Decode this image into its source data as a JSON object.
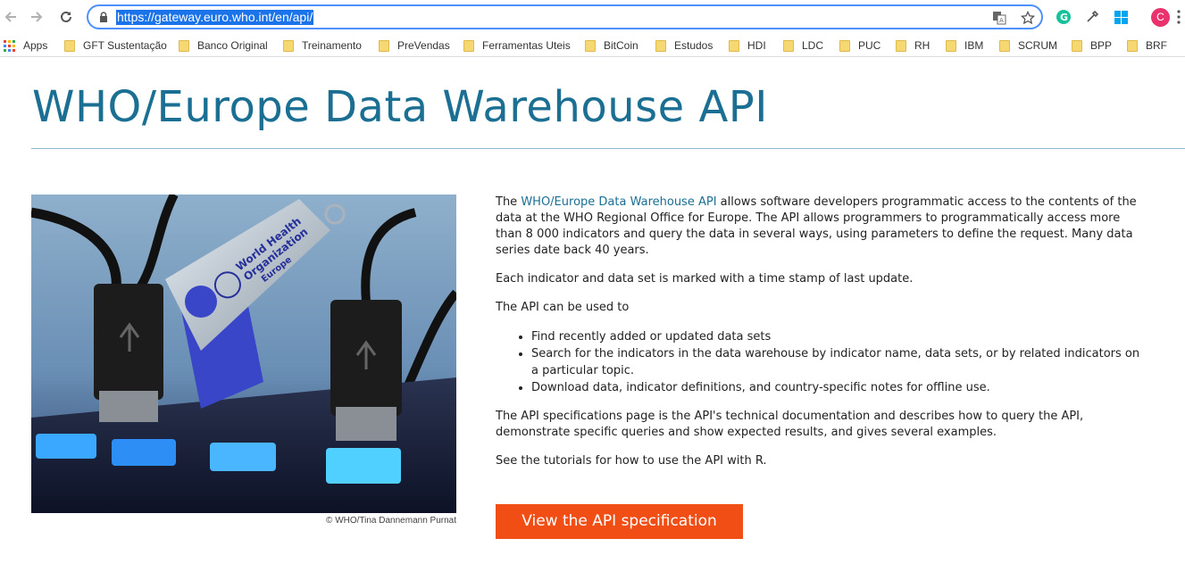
{
  "browser": {
    "url": "https://gateway.euro.who.int/en/api/",
    "avatar_letter": "C",
    "icons": {
      "back": "arrow-left-icon",
      "forward": "arrow-right-icon",
      "reload": "reload-icon",
      "lock": "lock-icon",
      "translate": "translate-icon",
      "bookmark": "star-icon",
      "grammarly": "grammarly-icon",
      "eyedropper": "eyedropper-icon",
      "windows": "windows-icon",
      "menu": "kebab-menu-icon"
    }
  },
  "bookmarks": [
    {
      "label": "Apps",
      "icon": "apps-grid-icon"
    },
    {
      "label": "GFT Sustentação",
      "icon": "folder-icon"
    },
    {
      "label": "Banco Original",
      "icon": "folder-icon"
    },
    {
      "label": "Treinamento",
      "icon": "folder-icon"
    },
    {
      "label": "PreVendas",
      "icon": "folder-icon"
    },
    {
      "label": "Ferramentas Uteis",
      "icon": "folder-icon"
    },
    {
      "label": "BitCoin",
      "icon": "folder-icon"
    },
    {
      "label": "Estudos",
      "icon": "folder-icon"
    },
    {
      "label": "HDI",
      "icon": "folder-icon"
    },
    {
      "label": "LDC",
      "icon": "folder-icon"
    },
    {
      "label": "PUC",
      "icon": "folder-icon"
    },
    {
      "label": "RH",
      "icon": "folder-icon"
    },
    {
      "label": "IBM",
      "icon": "folder-icon"
    },
    {
      "label": "SCRUM",
      "icon": "folder-icon"
    },
    {
      "label": "BPP",
      "icon": "folder-icon"
    },
    {
      "label": "BRF",
      "icon": "folder-icon"
    }
  ],
  "page": {
    "title": "WHO/Europe Data Warehouse API",
    "image_credit": "© WHO/Tina Dannemann Purnat",
    "usb_text_1": "World Health",
    "usb_text_2": "Organization",
    "usb_text_3": "Europe",
    "intro_prefix": "The ",
    "intro_link": "WHO/Europe Data Warehouse API",
    "intro_rest": " allows software developers programmatic access to the contents of the data at the WHO Regional Office for Europe. The API allows programmers to programmatically access more than 8 000 indicators and query the data in several ways, using parameters to define the request. Many data series date back 40 years.",
    "timestamp_note": "Each indicator and data set is marked with a time stamp of last update.",
    "uses_intro": "The API can be used to",
    "uses": [
      "Find recently added or updated data sets",
      "Search for the indicators in the data warehouse by indicator name, data sets, or by related indicators on a particular topic.",
      "Download data, indicator definitions, and country-specific notes for offline use."
    ],
    "spec_note": "The API specifications page is the API's technical documentation and describes how to query the API, demonstrate specific queries and show expected results, and gives several examples.",
    "tutorial_note": "See the tutorials for how to use the API with R.",
    "button_label": "View the API specification",
    "colors": {
      "title": "#1b6f92",
      "link": "#1b6f92",
      "button": "#f04e14"
    }
  }
}
